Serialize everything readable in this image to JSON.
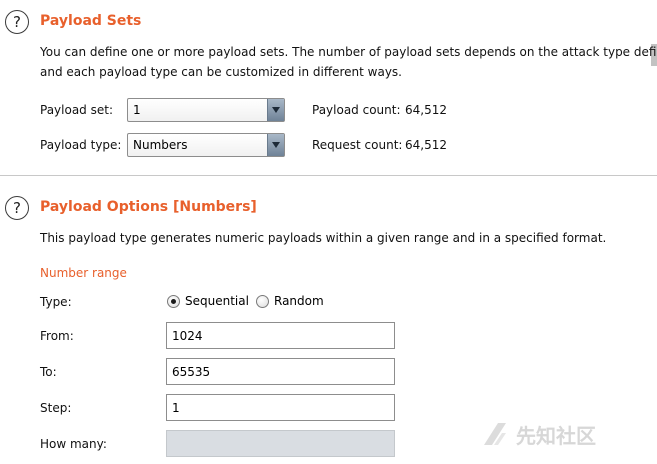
{
  "payload_sets": {
    "title": "Payload Sets",
    "description_line1": "You can define one or more payload sets. The number of payload sets depends on the attack type defined",
    "description_line2": "and each payload type can be customized in different ways.",
    "payload_set_label": "Payload set:",
    "payload_set_value": "1",
    "payload_type_label": "Payload type:",
    "payload_type_value": "Numbers",
    "payload_count_label": "Payload count:",
    "payload_count_value": "64,512",
    "request_count_label": "Request count:",
    "request_count_value": "64,512"
  },
  "payload_options": {
    "title": "Payload Options [Numbers]",
    "description": "This payload type generates numeric payloads within a given range and in a specified format.",
    "number_range_heading": "Number range",
    "type_label": "Type:",
    "type_options": [
      {
        "label": "Sequential",
        "checked": true
      },
      {
        "label": "Random",
        "checked": false
      }
    ],
    "from_label": "From:",
    "from_value": "1024",
    "to_label": "To:",
    "to_value": "65535",
    "step_label": "Step:",
    "step_value": "1",
    "how_many_label": "How many:",
    "how_many_value": ""
  },
  "help_icon_glyph": "?",
  "watermark": {
    "text": "先知社区",
    "icon": "xianzhi-logo-icon"
  },
  "colors": {
    "accent": "#e8602c",
    "divider": "#c8c8c8",
    "disabled_field": "#d9dde2"
  }
}
